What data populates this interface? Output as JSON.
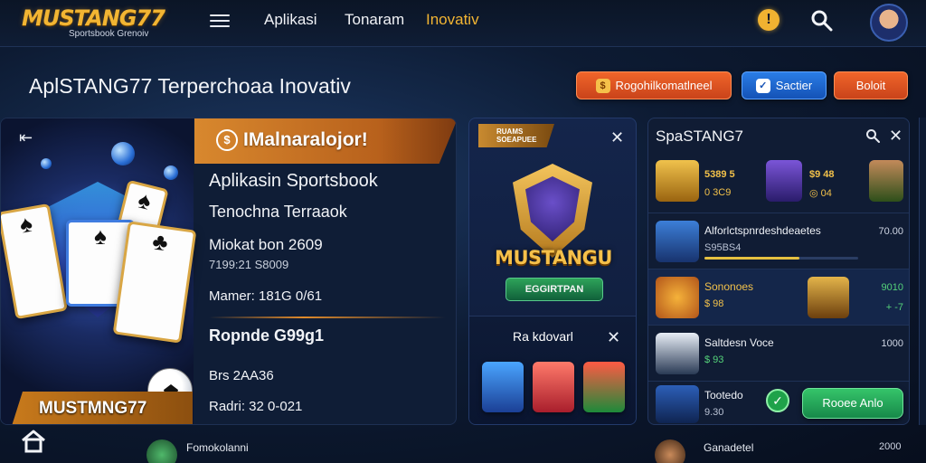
{
  "logo": {
    "name": "MUSTANG77",
    "subtitle": "Sportsbook Grenoiv"
  },
  "nav": {
    "items": [
      {
        "label": "Aplikasi"
      },
      {
        "label": "Tonaram"
      },
      {
        "label": "Inovativ",
        "active": true
      }
    ]
  },
  "header": {
    "icons": [
      "alert-icon",
      "search-icon",
      "avatar"
    ]
  },
  "page": {
    "title": "AplSTANG77 Terperchoaa  Inovativ",
    "buttons": [
      {
        "label": "Rogohilkomatlneel"
      },
      {
        "label": "Sactier"
      },
      {
        "label": "Boloit"
      }
    ]
  },
  "hero": {
    "badge": "MUSTMNG77",
    "banner": "IMalnaralojor!",
    "line1": "Aplikasin Sportsbook",
    "line2": "Tenochna Terraaok",
    "line3": "Miokat bon 2609",
    "line4": "7199:21 S8009",
    "line5": "Mamer: 181G 0/61",
    "line6": "Ropnde G99g1",
    "line7": "Brs 2AA36",
    "line8": "Radri: 32 0-021"
  },
  "mid": {
    "badge": "RUAMS SOEAPUEE",
    "title": "MUSTANGU",
    "button": "EGGIRTPAN",
    "subtitle": "Ra kdovarl"
  },
  "right": {
    "title": "SpaSTANG7",
    "rows": [
      {
        "title": "",
        "sub": "",
        "score": "",
        "extra": [
          "5389 5",
          "0 3C9",
          "$9 48",
          "◎ 04"
        ]
      },
      {
        "title": "Alforlctspnrdeshdeaetes",
        "sub": "S95BS4",
        "score": "70.00",
        "progress": 0.62
      },
      {
        "title": "Sononoes",
        "sub": "$ 98",
        "score": "9010",
        "score2": "+ -7"
      },
      {
        "title": "Saltdesn Voce",
        "sub": "$ 93",
        "score": "1000"
      },
      {
        "title": "Tootedo",
        "sub": "9.30",
        "button": "Rooee Anlo"
      }
    ],
    "bottom": {
      "title": "Ganadetel",
      "score": "2000"
    }
  },
  "bottom_left": {
    "label": "Fomokolanni"
  },
  "colors": {
    "accent": "#f2b533",
    "orange": "#f0652a",
    "blue": "#2a7de6",
    "green": "#35c46a",
    "bg": "#0d1b33"
  }
}
